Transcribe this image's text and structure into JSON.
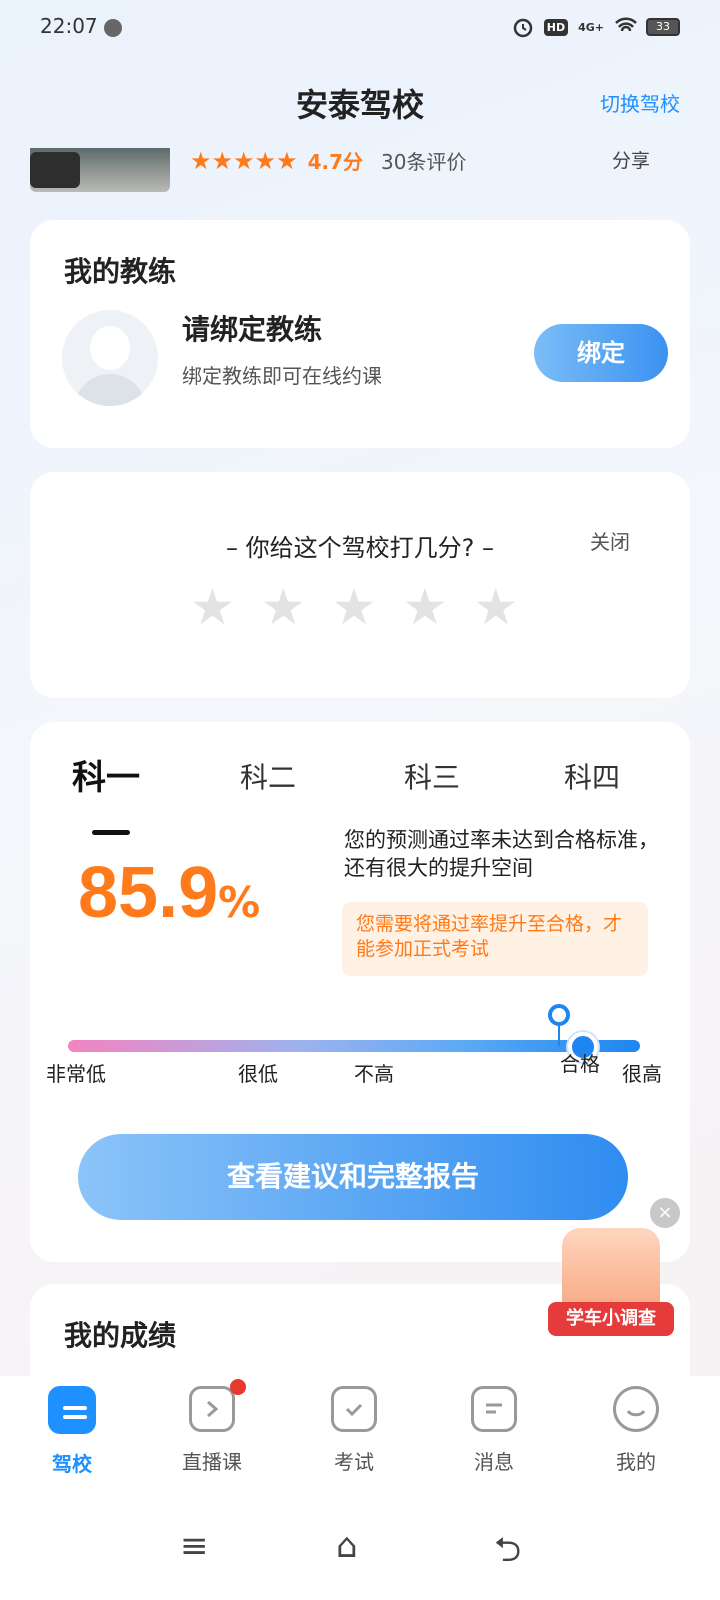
{
  "status": {
    "time": "22:07",
    "battery": "33",
    "hd": "HD",
    "network": "4G+"
  },
  "header": {
    "title": "安泰驾校",
    "switch_label": "切换驾校"
  },
  "school": {
    "stars": "★★★★★",
    "score": "4.7分",
    "reviews": "30条评价",
    "share": "分享"
  },
  "coach": {
    "heading": "我的教练",
    "name": "请绑定教练",
    "desc": "绑定教练即可在线约课",
    "bind_label": "绑定"
  },
  "rate": {
    "question": "– 你给这个驾校打几分? –",
    "close": "关闭",
    "star": "★"
  },
  "exam": {
    "tabs": [
      "科一",
      "科二",
      "科三",
      "科四"
    ],
    "percent": "85.9",
    "percent_unit": "%",
    "message": "您的预测通过率未达到合格标准，还有很大的提升空间",
    "warning": "您需要将通过率提升至合格，才能参加正式考试",
    "levels": [
      "非常低",
      "很低",
      "不高",
      "合格",
      "很高"
    ],
    "report_label": "查看建议和完整报告"
  },
  "scores": {
    "heading": "我的成绩"
  },
  "survey": {
    "label": "学车小调查",
    "close": "×"
  },
  "nav": [
    {
      "label": "驾校"
    },
    {
      "label": "直播课"
    },
    {
      "label": "考试"
    },
    {
      "label": "消息"
    },
    {
      "label": "我的"
    }
  ],
  "system": {
    "menu": "≡",
    "home": "⌂",
    "back": "⮌"
  },
  "colors": {
    "accent": "#1e90ff",
    "orange": "#ff7a1a",
    "red": "#e8392e"
  }
}
